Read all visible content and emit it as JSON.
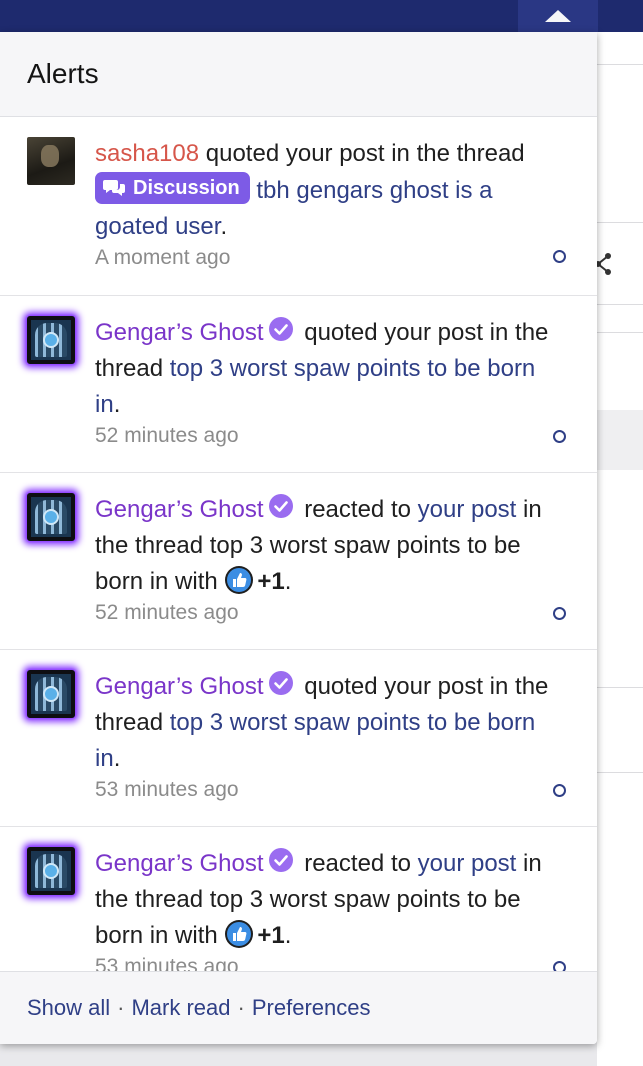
{
  "header": {
    "title": "Alerts"
  },
  "alerts": [
    {
      "user": "sasha108",
      "action": "quoted your post in the thread",
      "badge": "Discussion",
      "thread": "tbh gengars ghost is a goated user",
      "end": ".",
      "time": "A moment ago"
    },
    {
      "user": "Gengar’s Ghost",
      "action": "quoted your post in the thread",
      "thread": "top 3 worst spaw points to be born in",
      "end": ".",
      "time": "52 minutes ago"
    },
    {
      "user": "Gengar’s Ghost",
      "action": "reacted to",
      "post_link": "your post",
      "middle": "in the thread top 3 worst spaw points to be born in with",
      "reaction": "+1",
      "end": ".",
      "time": "52 minutes ago"
    },
    {
      "user": "Gengar’s Ghost",
      "action": "quoted your post in the thread",
      "thread": "top 3 worst spaw points to be born in",
      "end": ".",
      "time": "53 minutes ago"
    },
    {
      "user": "Gengar’s Ghost",
      "action": "reacted to",
      "post_link": "your post",
      "middle": "in the thread top 3 worst spaw points to be born in with",
      "reaction": "+1",
      "end": ".",
      "time": "53 minutes ago"
    }
  ],
  "footer": {
    "show_all": "Show all",
    "separator": "·",
    "mark_read": "Mark read",
    "preferences": "Preferences"
  },
  "colors": {
    "nav": "#1e2a6e",
    "link": "#2f3f86",
    "username_red": "#d6564a",
    "username_purple": "#7a35c9",
    "badge": "#7d5be6"
  }
}
